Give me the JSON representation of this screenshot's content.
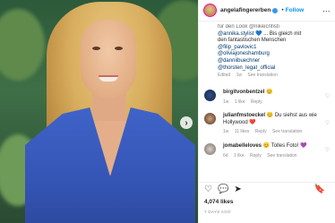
{
  "post": {
    "username": "angelafingererben",
    "separator": "•",
    "follow_label": "Follow",
    "more_label": "...",
    "slide_next_icon": "chevron-right-icon"
  },
  "caption": {
    "line1": "für den Look @nikeicnfisti",
    "line2_tag": "@annika.stylist",
    "line2_rest": " 💙 ... Bis gleich mit",
    "line3": "den fantastischen Menschen",
    "tags": [
      "@filip_pavlovic1",
      "@oliviajoneshamburg",
      "@danniibuechner",
      "@thorsten_legat_official"
    ],
    "meta_edited": "Edited",
    "meta_age": "1w",
    "meta_translation": "See translation"
  },
  "comments": [
    {
      "user": "birgitvonbentzel",
      "text": "😊",
      "age": "1w",
      "likes": "1 like",
      "reply": "Reply",
      "translation": ""
    },
    {
      "user": "julianfmstoeckel",
      "text": "😊 Du siehst aus wie Hollywood ❤️",
      "age": "1w",
      "likes": "11 likes",
      "reply": "Reply",
      "translation": "See translation"
    },
    {
      "user": "jomabelleloves",
      "text": "😊 Tolles Foto! 💜",
      "age": "6d",
      "likes": "1 like",
      "reply": "Reply",
      "translation": "See translation"
    }
  ],
  "actions": {
    "like": "♡",
    "comment": "💬",
    "share": "➤",
    "save": "🔖"
  },
  "stats": {
    "likes": "4,074 likes",
    "age": "7 DAYS AGO"
  }
}
